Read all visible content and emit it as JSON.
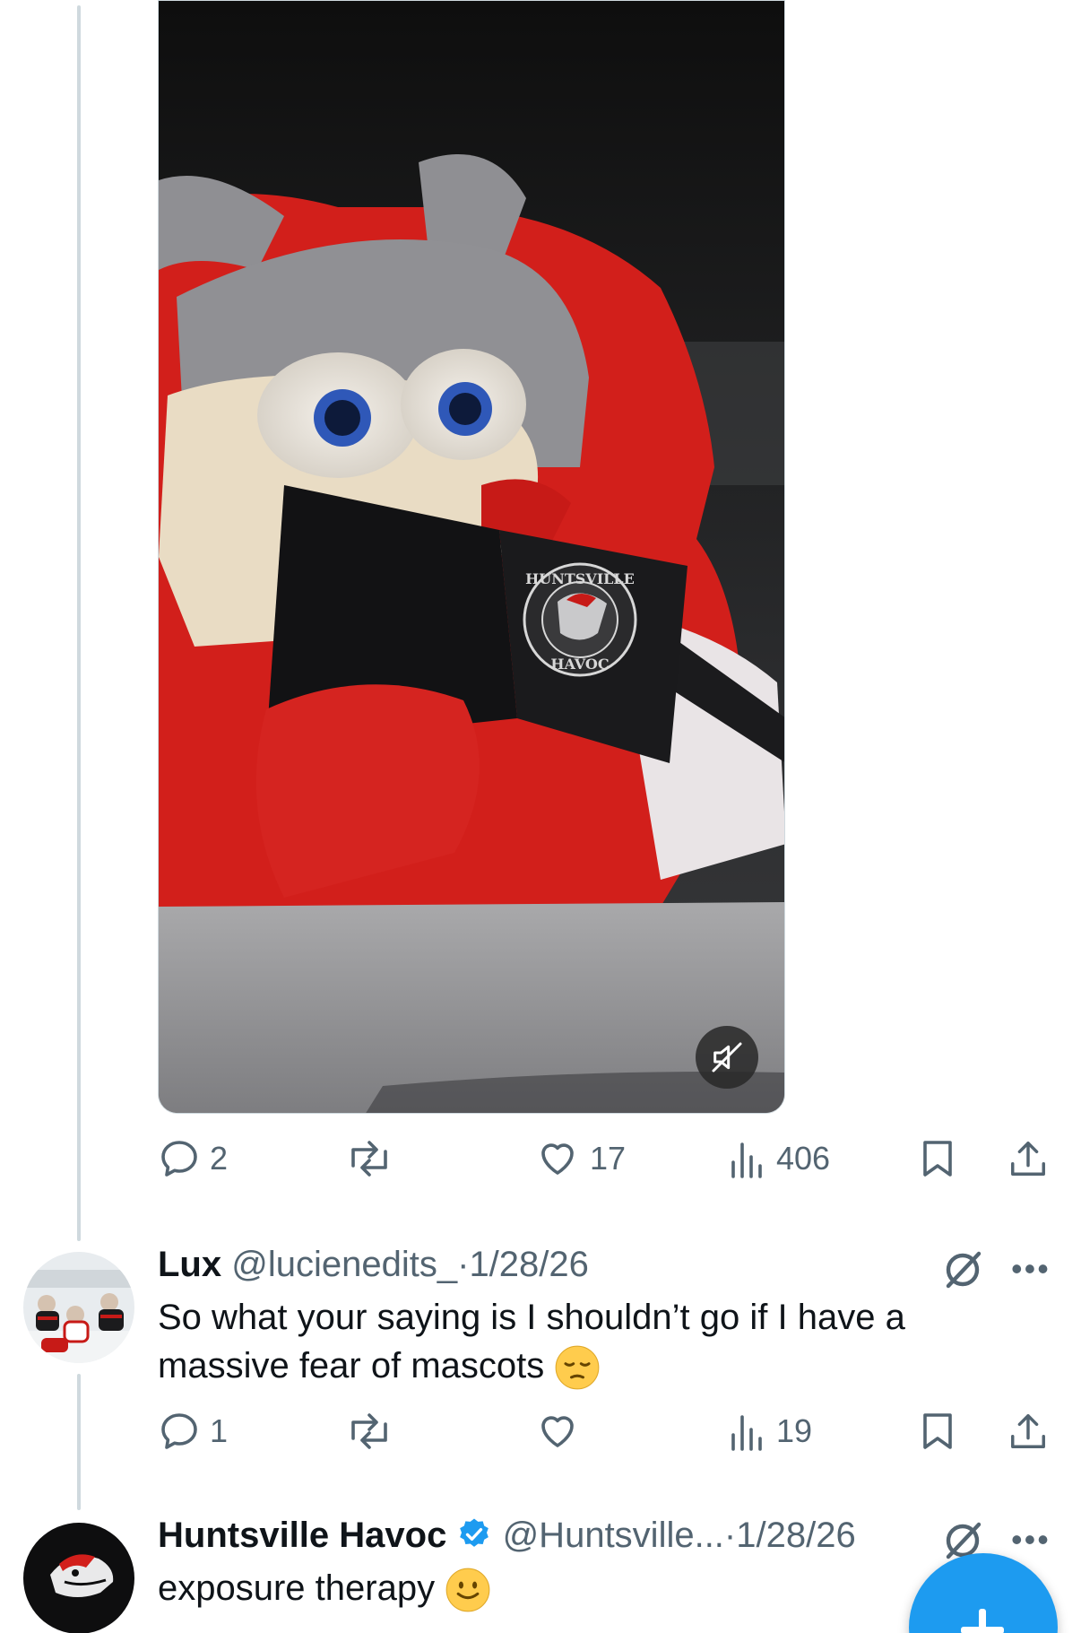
{
  "main_tweet": {
    "media": {
      "description_icon": "mascot-video",
      "logo_text_top": "HUNTSVILLE",
      "logo_text_bottom": "HAVOC"
    },
    "stats": {
      "replies": "2",
      "reposts": "",
      "likes": "17",
      "views": "406"
    }
  },
  "reply_1": {
    "display_name": "Lux",
    "handle": "@lucienedits_",
    "separator": "·",
    "date": "1/28/26",
    "text_line1": "So what your saying is I shouldn’t go if I have a",
    "text_line2": "massive fear of mascots",
    "emoji": "pensive-face",
    "stats": {
      "replies": "1",
      "reposts": "",
      "likes": "",
      "views": "19"
    }
  },
  "reply_2": {
    "display_name": "Huntsville Havoc",
    "handle": "@Huntsville...",
    "separator": "·",
    "date": "1/28/26",
    "text": "exposure therapy",
    "emoji": "slightly-smiling-face",
    "verified": true
  },
  "colors": {
    "accent": "#1d9bf0",
    "muted": "#536471",
    "text": "#0f1419",
    "thread_line": "#cfd9de"
  },
  "icons": [
    "reply-icon",
    "repost-icon",
    "like-icon",
    "views-icon",
    "bookmark-icon",
    "share-icon",
    "grok-icon",
    "more-icon",
    "mute-icon",
    "compose-icon",
    "verified-badge-icon"
  ]
}
